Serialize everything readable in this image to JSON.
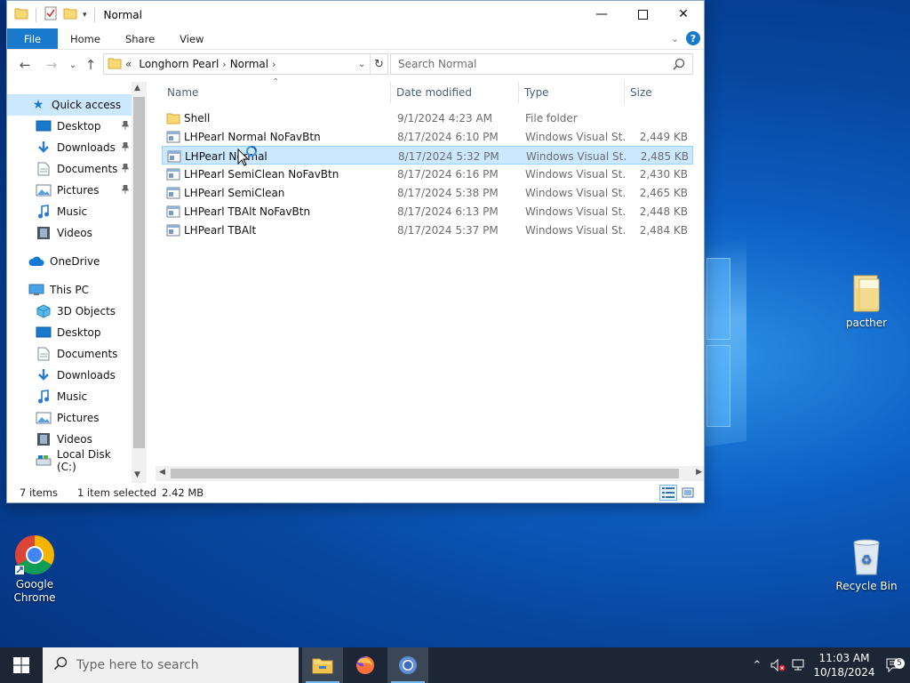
{
  "window": {
    "title": "Normal",
    "ribbon_tabs": [
      "File",
      "Home",
      "Share",
      "View"
    ]
  },
  "address": {
    "overflow": "«",
    "crumbs": [
      "Longhorn Pearl",
      "Normal"
    ],
    "search_placeholder": "Search Normal"
  },
  "nav": {
    "quick_access": "Quick access",
    "qa_items": [
      "Desktop",
      "Downloads",
      "Documents",
      "Pictures",
      "Music",
      "Videos"
    ],
    "onedrive": "OneDrive",
    "this_pc": "This PC",
    "pc_items": [
      "3D Objects",
      "Desktop",
      "Documents",
      "Downloads",
      "Music",
      "Pictures",
      "Videos",
      "Local Disk (C:)"
    ]
  },
  "columns": {
    "name": "Name",
    "date": "Date modified",
    "type": "Type",
    "size": "Size"
  },
  "files": [
    {
      "name": "Shell",
      "date": "9/1/2024 4:23 AM",
      "type": "File folder",
      "size": "",
      "kind": "folder"
    },
    {
      "name": "LHPearl Normal NoFavBtn",
      "date": "8/17/2024 6:10 PM",
      "type": "Windows Visual St...",
      "size": "2,449 KB",
      "kind": "style"
    },
    {
      "name": "LHPearl Normal",
      "date": "8/17/2024 5:32 PM",
      "type": "Windows Visual St...",
      "size": "2,485 KB",
      "kind": "style"
    },
    {
      "name": "LHPearl SemiClean NoFavBtn",
      "date": "8/17/2024 6:16 PM",
      "type": "Windows Visual St...",
      "size": "2,430 KB",
      "kind": "style"
    },
    {
      "name": "LHPearl SemiClean",
      "date": "8/17/2024 5:38 PM",
      "type": "Windows Visual St...",
      "size": "2,465 KB",
      "kind": "style"
    },
    {
      "name": "LHPearl TBAlt NoFavBtn",
      "date": "8/17/2024 6:13 PM",
      "type": "Windows Visual St...",
      "size": "2,448 KB",
      "kind": "style"
    },
    {
      "name": "LHPearl TBAlt",
      "date": "8/17/2024 5:37 PM",
      "type": "Windows Visual St...",
      "size": "2,484 KB",
      "kind": "style"
    }
  ],
  "status": {
    "count": "7 items",
    "selection": "1 item selected",
    "size": "2.42 MB"
  },
  "desktop_icons": {
    "pacther": "pacther",
    "recycle": "Recycle Bin",
    "chrome_line1": "Google",
    "chrome_line2": "Chrome"
  },
  "taskbar": {
    "search_placeholder": "Type here to search",
    "time": "11:03 AM",
    "date": "10/18/2024",
    "notification_count": "5"
  },
  "colors": {
    "accent": "#1979ca",
    "selection": "#cce8ff"
  }
}
